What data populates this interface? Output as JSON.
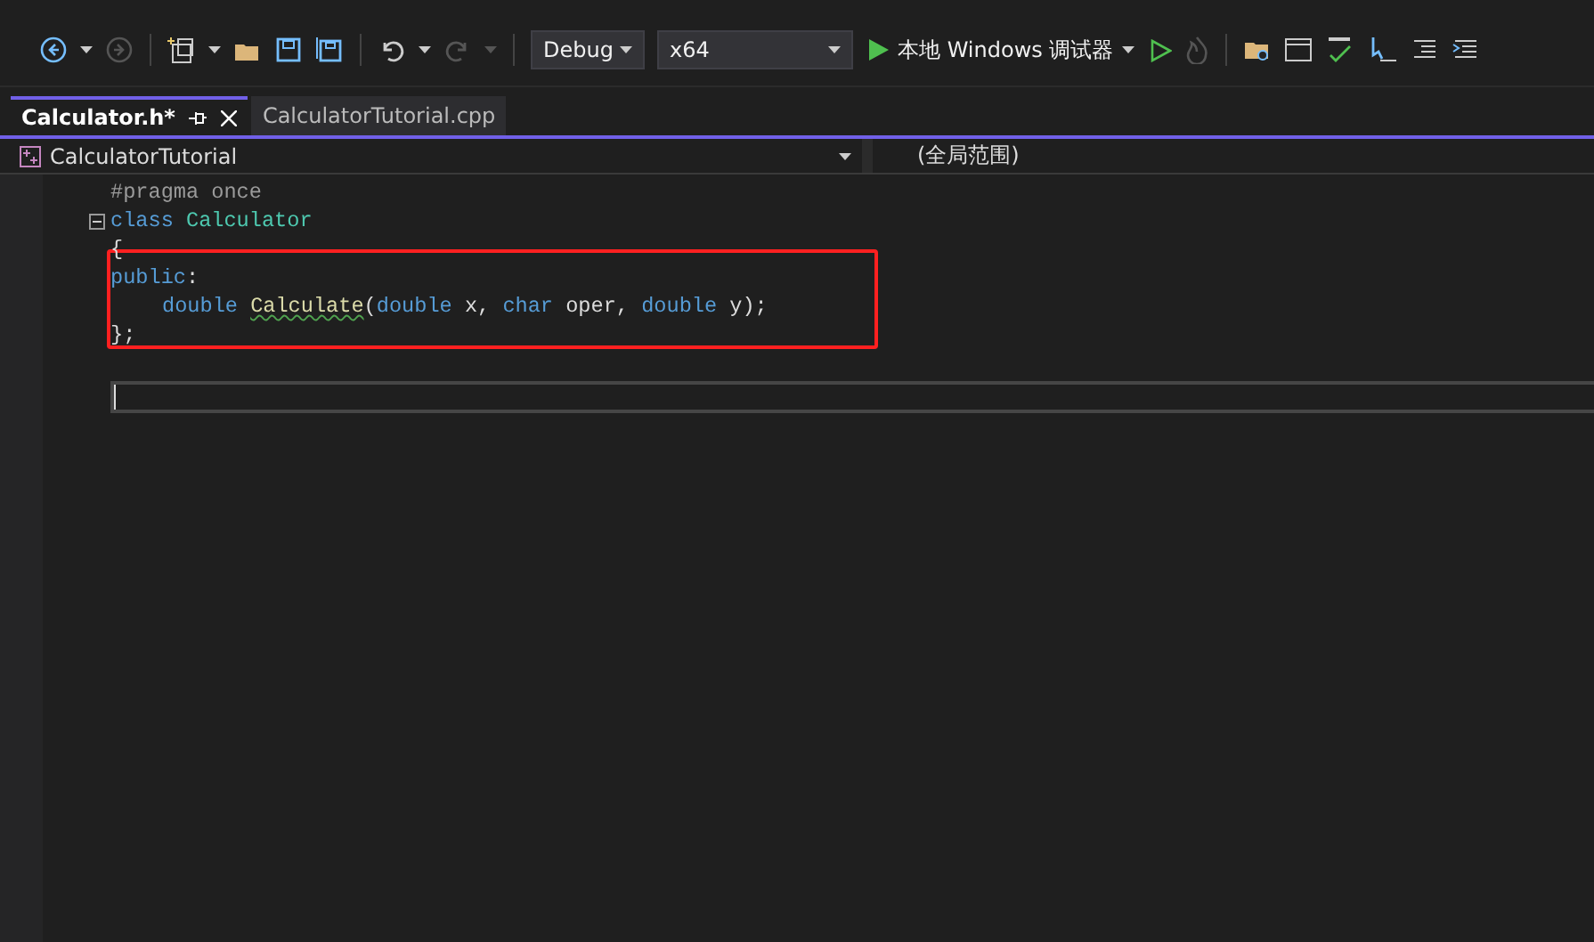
{
  "toolbar": {
    "configuration": "Debug",
    "platform": "x64",
    "run_label": "本地 Windows 调试器"
  },
  "tabs": [
    {
      "label": "Calculator.h*",
      "selected": true
    },
    {
      "label": "CalculatorTutorial.cpp",
      "selected": false
    }
  ],
  "navigation_bar": {
    "project": "CalculatorTutorial",
    "scope": "(全局范围)"
  },
  "editor": {
    "lines": [
      {
        "fold": false,
        "indented": false,
        "tokens": [
          {
            "kind": "preproc",
            "text": "#pragma once"
          }
        ]
      },
      {
        "fold": true,
        "indented": false,
        "tokens": [
          {
            "kind": "keyword",
            "text": "class "
          },
          {
            "kind": "type",
            "text": "Calculator"
          }
        ]
      },
      {
        "fold": false,
        "indented": false,
        "tokens": [
          {
            "kind": "plain",
            "text": "{"
          }
        ]
      },
      {
        "fold": false,
        "indented": false,
        "tokens": [
          {
            "kind": "keyword",
            "text": "public"
          },
          {
            "kind": "plain",
            "text": ":"
          }
        ]
      },
      {
        "fold": false,
        "indented": true,
        "tokens": [
          {
            "kind": "keyword",
            "text": "double "
          },
          {
            "kind": "func",
            "text": "Calculate",
            "squiggle": true
          },
          {
            "kind": "plain",
            "text": "("
          },
          {
            "kind": "keyword",
            "text": "double"
          },
          {
            "kind": "plain",
            "text": " x, "
          },
          {
            "kind": "keyword",
            "text": "char"
          },
          {
            "kind": "plain",
            "text": " oper, "
          },
          {
            "kind": "keyword",
            "text": "double"
          },
          {
            "kind": "plain",
            "text": " y);"
          }
        ]
      },
      {
        "fold": false,
        "indented": false,
        "tokens": [
          {
            "kind": "plain",
            "text": "};"
          }
        ]
      },
      {
        "fold": false
      }
    ]
  }
}
